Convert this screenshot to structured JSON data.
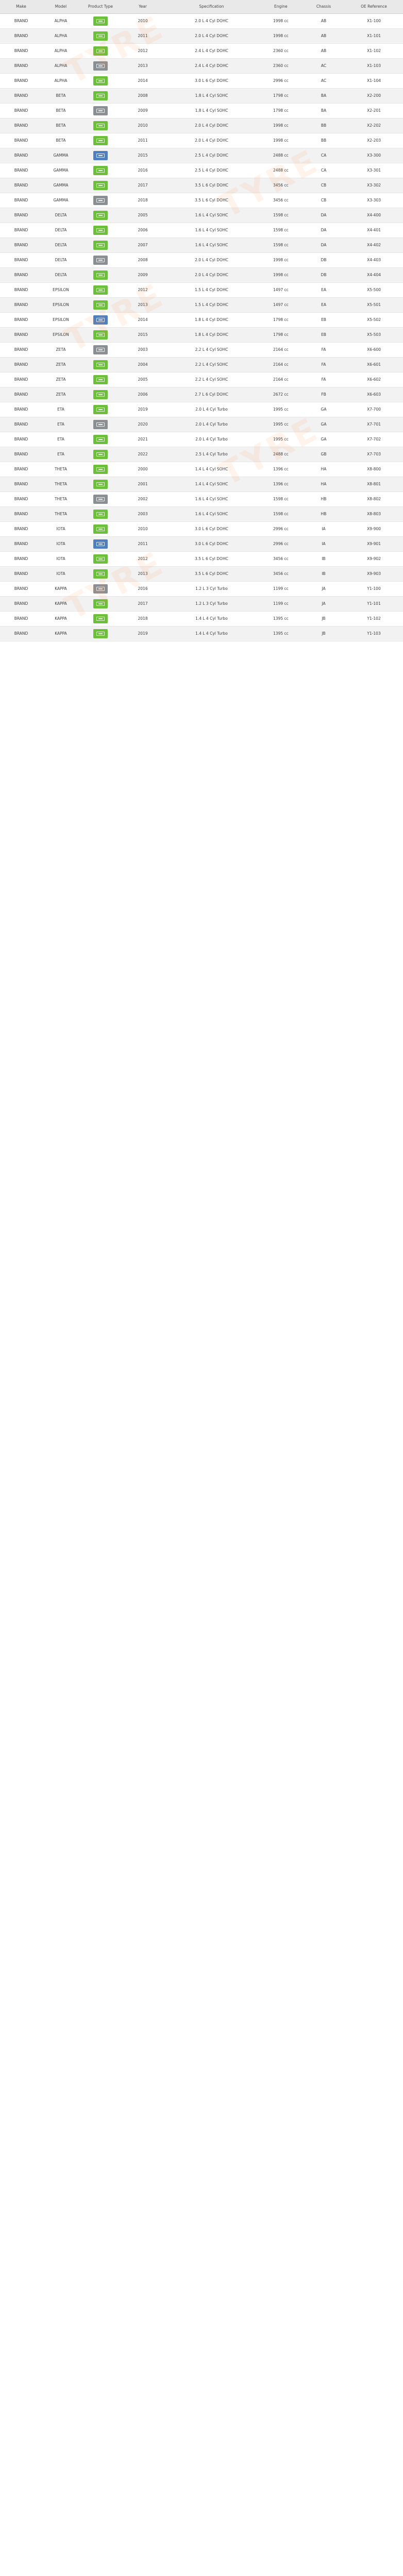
{
  "catalog": {
    "columns": [
      "Make",
      "Model",
      "Product Type",
      "Year",
      "Specification",
      "Engine",
      "Chassis",
      "OE Reference"
    ],
    "badge_colors": {
      "green": "#6cbf3a",
      "gray": "#8a8f94",
      "blue": "#4f7fbf"
    },
    "watermark_text": "TYRE",
    "rows": [
      [
        "BRAND",
        "ALPHA",
        "green",
        "2010",
        "2.0 L  4 Cyl  DOHC",
        "1998 cc",
        "AB",
        "X1-100"
      ],
      [
        "BRAND",
        "ALPHA",
        "green",
        "2011",
        "2.0 L  4 Cyl  DOHC",
        "1998 cc",
        "AB",
        "X1-101"
      ],
      [
        "BRAND",
        "ALPHA",
        "green",
        "2012",
        "2.4 L  4 Cyl  DOHC",
        "2360 cc",
        "AB",
        "X1-102"
      ],
      [
        "BRAND",
        "ALPHA",
        "gray",
        "2013",
        "2.4 L  4 Cyl  DOHC",
        "2360 cc",
        "AC",
        "X1-103"
      ],
      [
        "BRAND",
        "ALPHA",
        "green",
        "2014",
        "3.0 L  6 Cyl  DOHC",
        "2996 cc",
        "AC",
        "X1-104"
      ],
      [
        "BRAND",
        "BETA",
        "green",
        "2008",
        "1.8 L  4 Cyl  SOHC",
        "1798 cc",
        "BA",
        "X2-200"
      ],
      [
        "BRAND",
        "BETA",
        "gray",
        "2009",
        "1.8 L  4 Cyl  SOHC",
        "1798 cc",
        "BA",
        "X2-201"
      ],
      [
        "BRAND",
        "BETA",
        "green",
        "2010",
        "2.0 L  4 Cyl  DOHC",
        "1998 cc",
        "BB",
        "X2-202"
      ],
      [
        "BRAND",
        "BETA",
        "green",
        "2011",
        "2.0 L  4 Cyl  DOHC",
        "1998 cc",
        "BB",
        "X2-203"
      ],
      [
        "BRAND",
        "GAMMA",
        "blue",
        "2015",
        "2.5 L  4 Cyl  DOHC",
        "2488 cc",
        "CA",
        "X3-300"
      ],
      [
        "BRAND",
        "GAMMA",
        "green",
        "2016",
        "2.5 L  4 Cyl  DOHC",
        "2488 cc",
        "CA",
        "X3-301"
      ],
      [
        "BRAND",
        "GAMMA",
        "green",
        "2017",
        "3.5 L  6 Cyl  DOHC",
        "3456 cc",
        "CB",
        "X3-302"
      ],
      [
        "BRAND",
        "GAMMA",
        "gray",
        "2018",
        "3.5 L  6 Cyl  DOHC",
        "3456 cc",
        "CB",
        "X3-303"
      ],
      [
        "BRAND",
        "DELTA",
        "green",
        "2005",
        "1.6 L  4 Cyl  SOHC",
        "1598 cc",
        "DA",
        "X4-400"
      ],
      [
        "BRAND",
        "DELTA",
        "green",
        "2006",
        "1.6 L  4 Cyl  SOHC",
        "1598 cc",
        "DA",
        "X4-401"
      ],
      [
        "BRAND",
        "DELTA",
        "green",
        "2007",
        "1.6 L  4 Cyl  SOHC",
        "1598 cc",
        "DA",
        "X4-402"
      ],
      [
        "BRAND",
        "DELTA",
        "gray",
        "2008",
        "2.0 L  4 Cyl  DOHC",
        "1998 cc",
        "DB",
        "X4-403"
      ],
      [
        "BRAND",
        "DELTA",
        "green",
        "2009",
        "2.0 L  4 Cyl  DOHC",
        "1998 cc",
        "DB",
        "X4-404"
      ],
      [
        "BRAND",
        "EPSILON",
        "green",
        "2012",
        "1.5 L  4 Cyl  DOHC",
        "1497 cc",
        "EA",
        "X5-500"
      ],
      [
        "BRAND",
        "EPSILON",
        "green",
        "2013",
        "1.5 L  4 Cyl  DOHC",
        "1497 cc",
        "EA",
        "X5-501"
      ],
      [
        "BRAND",
        "EPSILON",
        "blue",
        "2014",
        "1.8 L  4 Cyl  DOHC",
        "1798 cc",
        "EB",
        "X5-502"
      ],
      [
        "BRAND",
        "EPSILON",
        "green",
        "2015",
        "1.8 L  4 Cyl  DOHC",
        "1798 cc",
        "EB",
        "X5-503"
      ],
      [
        "BRAND",
        "ZETA",
        "gray",
        "2003",
        "2.2 L  4 Cyl  SOHC",
        "2164 cc",
        "FA",
        "X6-600"
      ],
      [
        "BRAND",
        "ZETA",
        "green",
        "2004",
        "2.2 L  4 Cyl  SOHC",
        "2164 cc",
        "FA",
        "X6-601"
      ],
      [
        "BRAND",
        "ZETA",
        "green",
        "2005",
        "2.2 L  4 Cyl  SOHC",
        "2164 cc",
        "FA",
        "X6-602"
      ],
      [
        "BRAND",
        "ZETA",
        "green",
        "2006",
        "2.7 L  6 Cyl  DOHC",
        "2672 cc",
        "FB",
        "X6-603"
      ],
      [
        "BRAND",
        "ETA",
        "green",
        "2019",
        "2.0 L  4 Cyl  Turbo",
        "1995 cc",
        "GA",
        "X7-700"
      ],
      [
        "BRAND",
        "ETA",
        "gray",
        "2020",
        "2.0 L  4 Cyl  Turbo",
        "1995 cc",
        "GA",
        "X7-701"
      ],
      [
        "BRAND",
        "ETA",
        "green",
        "2021",
        "2.0 L  4 Cyl  Turbo",
        "1995 cc",
        "GA",
        "X7-702"
      ],
      [
        "BRAND",
        "ETA",
        "green",
        "2022",
        "2.5 L  4 Cyl  Turbo",
        "2488 cc",
        "GB",
        "X7-703"
      ],
      [
        "BRAND",
        "THETA",
        "green",
        "2000",
        "1.4 L  4 Cyl  SOHC",
        "1396 cc",
        "HA",
        "X8-800"
      ],
      [
        "BRAND",
        "THETA",
        "green",
        "2001",
        "1.4 L  4 Cyl  SOHC",
        "1396 cc",
        "HA",
        "X8-801"
      ],
      [
        "BRAND",
        "THETA",
        "gray",
        "2002",
        "1.6 L  4 Cyl  SOHC",
        "1598 cc",
        "HB",
        "X8-802"
      ],
      [
        "BRAND",
        "THETA",
        "green",
        "2003",
        "1.6 L  4 Cyl  SOHC",
        "1598 cc",
        "HB",
        "X8-803"
      ],
      [
        "BRAND",
        "IOTA",
        "green",
        "2010",
        "3.0 L  6 Cyl  DOHC",
        "2996 cc",
        "IA",
        "X9-900"
      ],
      [
        "BRAND",
        "IOTA",
        "blue",
        "2011",
        "3.0 L  6 Cyl  DOHC",
        "2996 cc",
        "IA",
        "X9-901"
      ],
      [
        "BRAND",
        "IOTA",
        "green",
        "2012",
        "3.5 L  6 Cyl  DOHC",
        "3456 cc",
        "IB",
        "X9-902"
      ],
      [
        "BRAND",
        "IOTA",
        "green",
        "2013",
        "3.5 L  6 Cyl  DOHC",
        "3456 cc",
        "IB",
        "X9-903"
      ],
      [
        "BRAND",
        "KAPPA",
        "gray",
        "2016",
        "1.2 L  3 Cyl  Turbo",
        "1199 cc",
        "JA",
        "Y1-100"
      ],
      [
        "BRAND",
        "KAPPA",
        "green",
        "2017",
        "1.2 L  3 Cyl  Turbo",
        "1199 cc",
        "JA",
        "Y1-101"
      ],
      [
        "BRAND",
        "KAPPA",
        "green",
        "2018",
        "1.4 L  4 Cyl  Turbo",
        "1395 cc",
        "JB",
        "Y1-102"
      ],
      [
        "BRAND",
        "KAPPA",
        "green",
        "2019",
        "1.4 L  4 Cyl  Turbo",
        "1395 cc",
        "JB",
        "Y1-103"
      ]
    ]
  }
}
